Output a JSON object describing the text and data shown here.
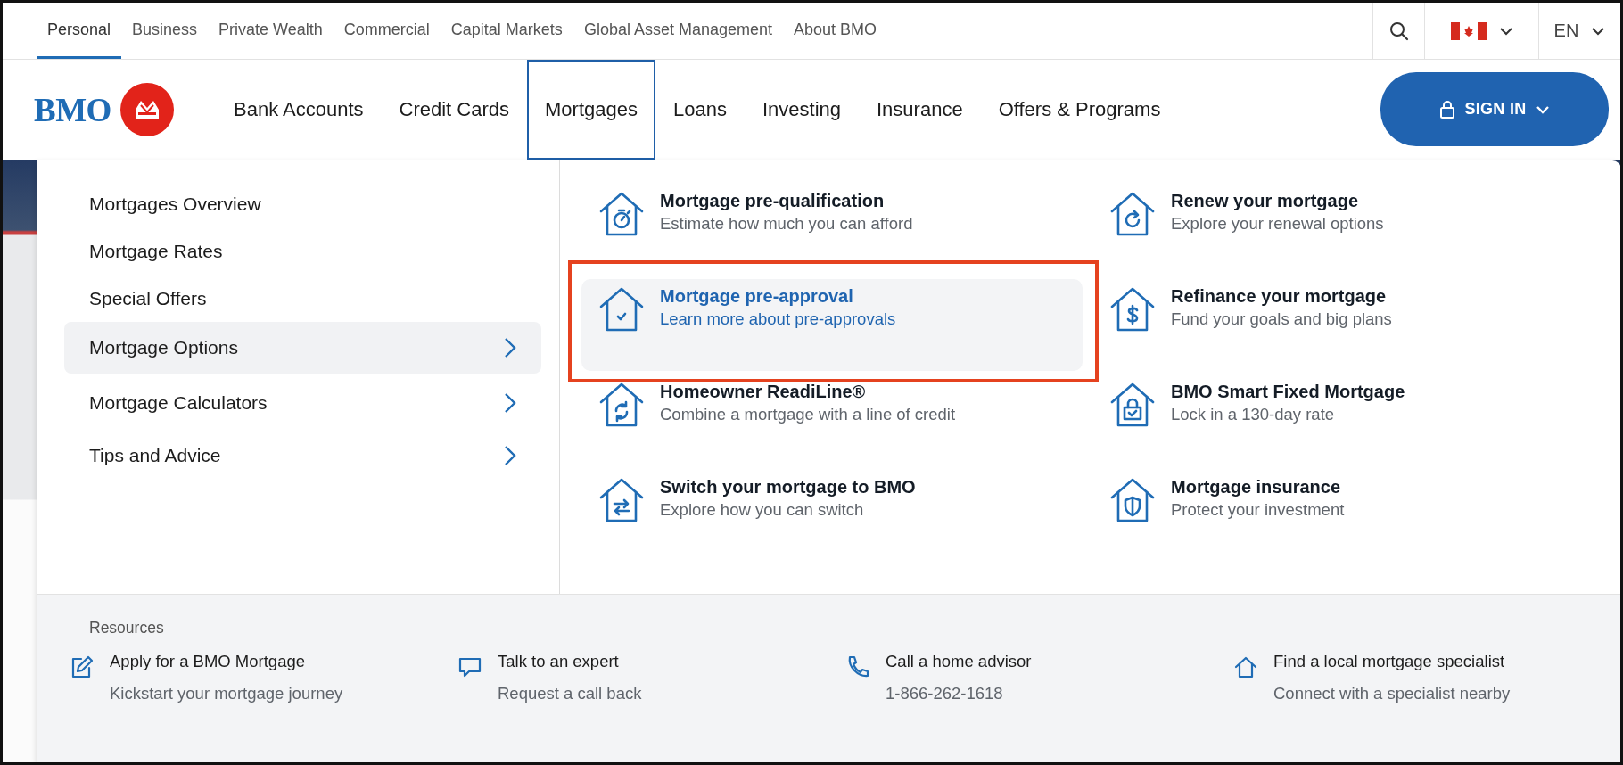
{
  "utility_nav": {
    "links": [
      {
        "label": "Personal",
        "selected": true
      },
      {
        "label": "Business",
        "selected": false
      },
      {
        "label": "Private Wealth",
        "selected": false
      },
      {
        "label": "Commercial",
        "selected": false
      },
      {
        "label": "Capital Markets",
        "selected": false
      },
      {
        "label": "Global Asset Management",
        "selected": false
      },
      {
        "label": "About BMO",
        "selected": false
      }
    ],
    "language": "EN"
  },
  "brand": {
    "name": "BMO"
  },
  "main_nav": {
    "items": [
      {
        "label": "Bank Accounts",
        "selected": false
      },
      {
        "label": "Credit Cards",
        "selected": false
      },
      {
        "label": "Mortgages",
        "selected": true
      },
      {
        "label": "Loans",
        "selected": false
      },
      {
        "label": "Investing",
        "selected": false
      },
      {
        "label": "Insurance",
        "selected": false
      },
      {
        "label": "Offers & Programs",
        "selected": false
      }
    ],
    "sign_in": "SIGN IN"
  },
  "mega_menu": {
    "sections": [
      {
        "label": "Mortgages Overview",
        "selected": false,
        "has_submenu": false
      },
      {
        "label": "Mortgage Rates",
        "selected": false,
        "has_submenu": false
      },
      {
        "label": "Special Offers",
        "selected": false,
        "has_submenu": false
      },
      {
        "label": "Mortgage Options",
        "selected": true,
        "has_submenu": true
      },
      {
        "label": "Mortgage Calculators",
        "selected": false,
        "has_submenu": true
      },
      {
        "label": "Tips and Advice",
        "selected": false,
        "has_submenu": true
      }
    ],
    "options": [
      {
        "kind": "timer",
        "title": "Mortgage pre-qualification",
        "subtitle": "Estimate how much you can afford",
        "selected": false,
        "outlined": false
      },
      {
        "kind": "renew",
        "title": "Renew your mortgage",
        "subtitle": "Explore your renewal options",
        "selected": false,
        "outlined": false
      },
      {
        "kind": "check",
        "title": "Mortgage pre-approval",
        "subtitle": "Learn more about pre-approvals",
        "selected": true,
        "outlined": true
      },
      {
        "kind": "dollar",
        "title": "Refinance your mortgage",
        "subtitle": "Fund your goals and big plans",
        "selected": false,
        "outlined": false
      },
      {
        "kind": "cycle",
        "title": "Homeowner ReadiLine®",
        "subtitle": "Combine a mortgage with a line of credit",
        "selected": false,
        "outlined": false
      },
      {
        "kind": "lock",
        "title": "BMO Smart Fixed Mortgage",
        "subtitle": "Lock in a 130-day rate",
        "selected": false,
        "outlined": false
      },
      {
        "kind": "switch",
        "title": "Switch your mortgage to BMO",
        "subtitle": "Explore how you can switch",
        "selected": false,
        "outlined": false
      },
      {
        "kind": "shield",
        "title": "Mortgage insurance",
        "subtitle": "Protect your investment",
        "selected": false,
        "outlined": false
      }
    ],
    "resources": {
      "heading": "Resources",
      "items": [
        {
          "kind": "edit",
          "title": "Apply for a BMO Mortgage",
          "subtitle": "Kickstart your mortgage journey"
        },
        {
          "kind": "chat",
          "title": "Talk to an expert",
          "subtitle": "Request a call back"
        },
        {
          "kind": "phone",
          "title": "Call a home advisor",
          "subtitle": "1-866-262-1618"
        },
        {
          "kind": "house",
          "title": "Find a local mortgage specialist",
          "subtitle": "Connect with a specialist nearby"
        }
      ]
    }
  }
}
